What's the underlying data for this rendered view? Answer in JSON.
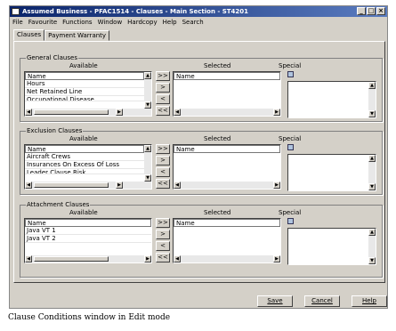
{
  "window": {
    "title": "Assumed Business - PFAC1514 - Clauses - Main Section - ST4201"
  },
  "titlebar_buttons": [
    "_",
    "□",
    "×"
  ],
  "menu": [
    "File",
    "Favourite",
    "Functions",
    "Window",
    "Hardcopy",
    "Help",
    "Search"
  ],
  "tabs": [
    "Clauses",
    "Payment Warranty"
  ],
  "column_headers": {
    "available": "Available",
    "selected": "Selected",
    "special": "Special",
    "name": "Name"
  },
  "transfer_buttons": [
    ">>",
    ">",
    "<",
    "<<"
  ],
  "groups": [
    {
      "title": "General Clauses",
      "available": [
        "Hours",
        "Net Retained Line",
        "Occupational Disease"
      ],
      "selected": []
    },
    {
      "title": "Exclusion Clauses",
      "available": [
        "Aircraft Crews",
        "Insurances On Excess Of Loss",
        "Leader Clause Risk"
      ],
      "selected": []
    },
    {
      "title": "Attachment Clauses",
      "available": [
        "Java VT 1",
        "Java VT 2"
      ],
      "selected": []
    }
  ],
  "footer_buttons": {
    "save": "Save",
    "cancel": "Cancel",
    "help": "Help"
  },
  "caption": "Clause Conditions window in Edit mode"
}
